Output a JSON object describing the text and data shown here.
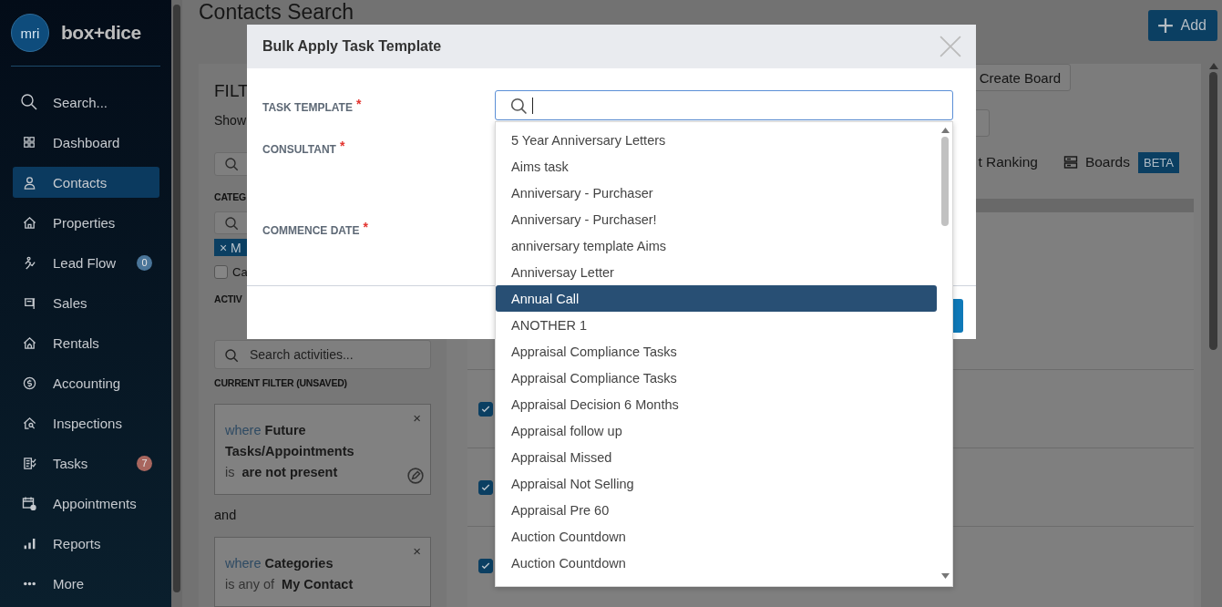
{
  "sidebar": {
    "logo_text": "mri",
    "brand": "box+dice",
    "items": [
      {
        "label": "Search...",
        "selected": false
      },
      {
        "label": "Dashboard",
        "selected": false
      },
      {
        "label": "Contacts",
        "selected": true
      },
      {
        "label": "Properties",
        "selected": false
      },
      {
        "label": "Lead Flow",
        "selected": false,
        "badge": {
          "text": "0",
          "color": "#4a7599"
        }
      },
      {
        "label": "Sales",
        "selected": false
      },
      {
        "label": "Rentals",
        "selected": false
      },
      {
        "label": "Accounting",
        "selected": false
      },
      {
        "label": "Inspections",
        "selected": false
      },
      {
        "label": "Tasks",
        "selected": false,
        "badge": {
          "text": "7",
          "color": "#a8665e"
        }
      },
      {
        "label": "Appointments",
        "selected": false
      },
      {
        "label": "Reports",
        "selected": false
      },
      {
        "label": "More",
        "selected": false
      }
    ]
  },
  "header": {
    "title": "Contacts Search",
    "add_button": "Add"
  },
  "filters": {
    "title": "FILT",
    "subtitle": "Show",
    "categories_heading": "CATEG",
    "chip": {
      "remove": "×",
      "label": "M"
    },
    "checkbox": {
      "label": "Ca",
      "checked": false
    },
    "activities_heading": "ACTIV",
    "activities_search": {
      "placeholder": "Search activities..."
    },
    "current_filter_heading": "CURRENT FILTER (UNSAVED)",
    "joiner": "and",
    "conditions": [
      {
        "prefix": "where",
        "field": "Future Tasks/Appointments",
        "operator": "is",
        "value": "are not present",
        "remove": "×"
      },
      {
        "prefix": "where",
        "field": "Categories",
        "operator": "is any of",
        "value": "My Contact",
        "remove": "×"
      }
    ]
  },
  "results": {
    "create_board": "Create Board",
    "ranking_tab": "t Ranking",
    "boards_tab": "Boards",
    "boards_badge": "BETA",
    "rows": [
      {
        "checked": true
      },
      {
        "checked": true
      },
      {
        "checked": true
      }
    ]
  },
  "modal": {
    "title": "Bulk Apply Task Template",
    "fields": [
      {
        "label": "TASK TEMPLATE",
        "required_mark": "*"
      },
      {
        "label": "CONSULTANT",
        "required_mark": "*"
      },
      {
        "label": "COMMENCE DATE",
        "required_mark": "*"
      }
    ],
    "dropdown": {
      "options": [
        {
          "label": "5 Year Anniversary Letters",
          "selected": false
        },
        {
          "label": "Aims task",
          "selected": false
        },
        {
          "label": "Anniversary - Purchaser",
          "selected": false
        },
        {
          "label": "Anniversary - Purchaser!",
          "selected": false
        },
        {
          "label": "anniversary template Aims",
          "selected": false
        },
        {
          "label": "Anniversay Letter",
          "selected": false
        },
        {
          "label": "Annual Call",
          "selected": true
        },
        {
          "label": "ANOTHER 1",
          "selected": false
        },
        {
          "label": "Appraisal Compliance Tasks",
          "selected": false
        },
        {
          "label": "Appraisal Compliance Tasks",
          "selected": false
        },
        {
          "label": "Appraisal Decision 6 Months",
          "selected": false
        },
        {
          "label": "Appraisal follow up",
          "selected": false
        },
        {
          "label": "Appraisal Missed",
          "selected": false
        },
        {
          "label": "Appraisal Not Selling",
          "selected": false
        },
        {
          "label": "Appraisal Pre 60",
          "selected": false
        },
        {
          "label": "Auction Countdown",
          "selected": false
        },
        {
          "label": "Auction Countdown",
          "selected": false
        }
      ]
    }
  }
}
